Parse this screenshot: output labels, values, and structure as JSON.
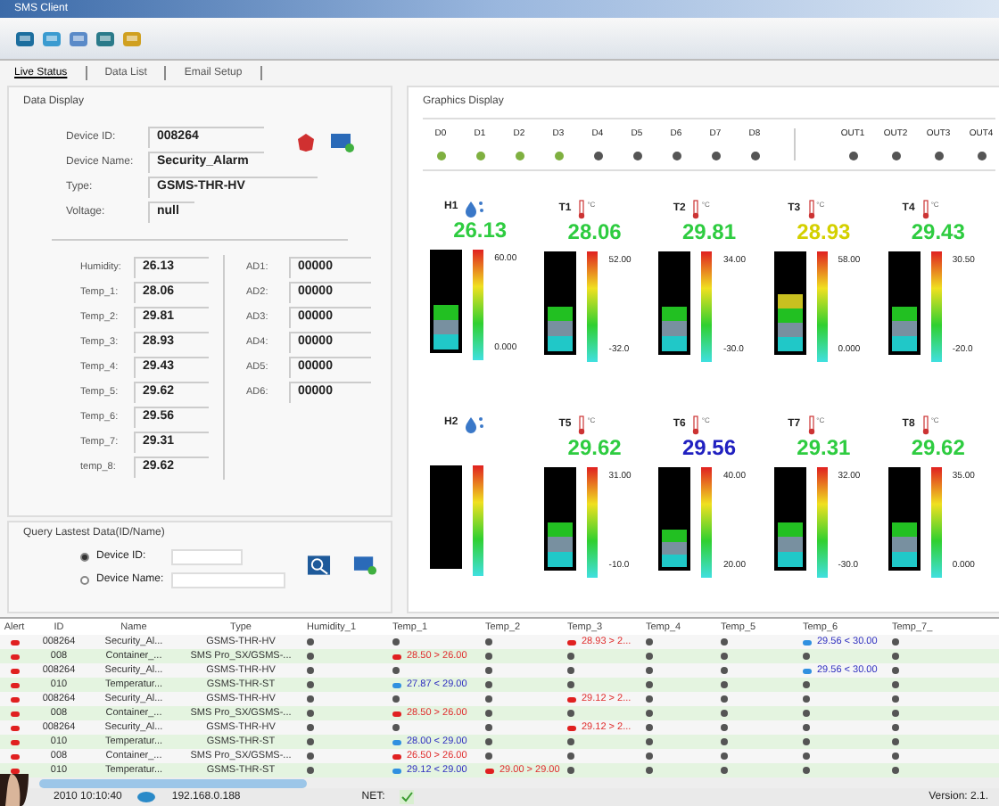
{
  "window": {
    "title": "SMS Client"
  },
  "tabs": [
    {
      "label": "Live Status",
      "selected": true
    },
    {
      "label": "Data List",
      "selected": false
    },
    {
      "label": "Email Setup",
      "selected": false
    }
  ],
  "data_display": {
    "title": "Data Display",
    "device_fields": [
      {
        "label": "Device ID:",
        "value": "008264"
      },
      {
        "label": "Device Name:",
        "value": "Security_Alarm"
      },
      {
        "label": "Type:",
        "value": "GSMS-THR-HV"
      },
      {
        "label": "Voltage:",
        "value": "null"
      }
    ],
    "readings": [
      {
        "label": "Humidity:",
        "value": "26.13"
      },
      {
        "label": "Temp_1:",
        "value": "28.06"
      },
      {
        "label": "Temp_2:",
        "value": "29.81"
      },
      {
        "label": "Temp_3:",
        "value": "28.93"
      },
      {
        "label": "Temp_4:",
        "value": "29.43"
      },
      {
        "label": "Temp_5:",
        "value": "29.62"
      },
      {
        "label": "Temp_6:",
        "value": "29.56"
      },
      {
        "label": "Temp_7:",
        "value": "29.31"
      },
      {
        "label": "temp_8:",
        "value": "29.62"
      }
    ],
    "analog": [
      {
        "label": "AD1:",
        "value": "00000"
      },
      {
        "label": "AD2:",
        "value": "00000"
      },
      {
        "label": "AD3:",
        "value": "00000"
      },
      {
        "label": "AD4:",
        "value": "00000"
      },
      {
        "label": "AD5:",
        "value": "00000"
      },
      {
        "label": "AD6:",
        "value": "00000"
      }
    ]
  },
  "query": {
    "title": "Query Lastest Data(ID/Name)",
    "options": [
      {
        "label": "Device ID:",
        "selected": true
      },
      {
        "label": "Device Name:",
        "selected": false
      }
    ]
  },
  "graphics": {
    "title": "Graphics Display",
    "inputs": [
      {
        "label": "D0",
        "on": true
      },
      {
        "label": "D1",
        "on": true
      },
      {
        "label": "D2",
        "on": true
      },
      {
        "label": "D3",
        "on": true
      },
      {
        "label": "D4",
        "on": false
      },
      {
        "label": "D5",
        "on": false
      },
      {
        "label": "D6",
        "on": false
      },
      {
        "label": "D7",
        "on": false
      },
      {
        "label": "D8",
        "on": false
      }
    ],
    "outputs": [
      {
        "label": "OUT1",
        "on": false
      },
      {
        "label": "OUT2",
        "on": false
      },
      {
        "label": "OUT3",
        "on": false
      },
      {
        "label": "OUT4",
        "on": false
      }
    ],
    "gauges": [
      {
        "name": "H1",
        "kind": "humidity",
        "value": "26.13",
        "color": "#2ecc40",
        "level": 0.45,
        "max": "60.00",
        "min": "0.000"
      },
      {
        "name": "T1",
        "kind": "temperature",
        "unit": "°C",
        "value": "28.06",
        "color": "#2ecc40",
        "level": 0.45,
        "max": "52.00",
        "min": "-32.0"
      },
      {
        "name": "T2",
        "kind": "temperature",
        "unit": "°C",
        "value": "29.81",
        "color": "#2ecc40",
        "level": 0.45,
        "max": "34.00",
        "min": "-30.0"
      },
      {
        "name": "T3",
        "kind": "temperature",
        "unit": "°C",
        "value": "28.93",
        "color": "#d4d000",
        "level": 0.58,
        "max": "58.00",
        "min": "0.000"
      },
      {
        "name": "T4",
        "kind": "temperature",
        "unit": "°C",
        "value": "29.43",
        "color": "#2ecc40",
        "level": 0.45,
        "max": "30.50",
        "min": "-20.0"
      },
      {
        "name": "H2",
        "kind": "humidity",
        "level": 0
      },
      {
        "name": "T5",
        "kind": "temperature",
        "unit": "°C",
        "value": "29.62",
        "color": "#2ecc40",
        "level": 0.45,
        "max": "31.00",
        "min": "-10.0"
      },
      {
        "name": "T6",
        "kind": "temperature",
        "unit": "°C",
        "value": "29.56",
        "color": "#2020c0",
        "level": 0.38,
        "max": "40.00",
        "min": "20.00"
      },
      {
        "name": "T7",
        "kind": "temperature",
        "unit": "°C",
        "value": "29.31",
        "color": "#2ecc40",
        "level": 0.45,
        "max": "32.00",
        "min": "-30.0"
      },
      {
        "name": "T8",
        "kind": "temperature",
        "unit": "°C",
        "value": "29.62",
        "color": "#2ecc40",
        "level": 0.45,
        "max": "35.00",
        "min": "0.000"
      }
    ]
  },
  "table": {
    "columns": [
      "Alert",
      "ID",
      "Name",
      "Type",
      "Humidity_1",
      "Temp_1",
      "Temp_2",
      "Temp_3",
      "Temp_4",
      "Temp_5",
      "Temp_6",
      "Temp_7_"
    ],
    "rows": [
      {
        "id": "008264",
        "name": "Security_Al...",
        "type": "GSMS-THR-HV",
        "sensors": [
          {
            "kind": "normal"
          },
          {
            "kind": "normal"
          },
          {
            "kind": "normal"
          },
          {
            "kind": "high",
            "text": "28.93 > 2..."
          },
          {
            "kind": "normal"
          },
          {
            "kind": "normal"
          },
          {
            "kind": "low",
            "text": "29.56 < 30.00"
          },
          {
            "kind": "normal"
          }
        ]
      },
      {
        "id": "008",
        "name": "Container_...",
        "type": "SMS Pro_SX/GSMS-...",
        "sensors": [
          {
            "kind": "normal"
          },
          {
            "kind": "high",
            "text": "28.50 > 26.00"
          },
          {
            "kind": "normal"
          },
          {
            "kind": "normal"
          },
          {
            "kind": "normal"
          },
          {
            "kind": "normal"
          },
          {
            "kind": "normal"
          },
          {
            "kind": "normal"
          }
        ]
      },
      {
        "id": "008264",
        "name": "Security_Al...",
        "type": "GSMS-THR-HV",
        "sensors": [
          {
            "kind": "normal"
          },
          {
            "kind": "normal"
          },
          {
            "kind": "normal"
          },
          {
            "kind": "normal"
          },
          {
            "kind": "normal"
          },
          {
            "kind": "normal"
          },
          {
            "kind": "low",
            "text": "29.56 < 30.00"
          },
          {
            "kind": "normal"
          }
        ]
      },
      {
        "id": "010",
        "name": "Temperatur...",
        "type": "GSMS-THR-ST",
        "sensors": [
          {
            "kind": "normal"
          },
          {
            "kind": "low",
            "text": "27.87 < 29.00"
          },
          {
            "kind": "normal"
          },
          {
            "kind": "normal"
          },
          {
            "kind": "normal"
          },
          {
            "kind": "normal"
          },
          {
            "kind": "normal"
          },
          {
            "kind": "normal"
          }
        ]
      },
      {
        "id": "008264",
        "name": "Security_Al...",
        "type": "GSMS-THR-HV",
        "sensors": [
          {
            "kind": "normal"
          },
          {
            "kind": "normal"
          },
          {
            "kind": "normal"
          },
          {
            "kind": "high",
            "text": "29.12 > 2..."
          },
          {
            "kind": "normal"
          },
          {
            "kind": "normal"
          },
          {
            "kind": "normal"
          },
          {
            "kind": "normal"
          }
        ]
      },
      {
        "id": "008",
        "name": "Container_...",
        "type": "SMS Pro_SX/GSMS-...",
        "sensors": [
          {
            "kind": "normal"
          },
          {
            "kind": "high",
            "text": "28.50 > 26.00"
          },
          {
            "kind": "normal"
          },
          {
            "kind": "normal"
          },
          {
            "kind": "normal"
          },
          {
            "kind": "normal"
          },
          {
            "kind": "normal"
          },
          {
            "kind": "normal"
          }
        ]
      },
      {
        "id": "008264",
        "name": "Security_Al...",
        "type": "GSMS-THR-HV",
        "sensors": [
          {
            "kind": "normal"
          },
          {
            "kind": "normal"
          },
          {
            "kind": "normal"
          },
          {
            "kind": "high",
            "text": "29.12 > 2..."
          },
          {
            "kind": "normal"
          },
          {
            "kind": "normal"
          },
          {
            "kind": "normal"
          },
          {
            "kind": "normal"
          }
        ]
      },
      {
        "id": "010",
        "name": "Temperatur...",
        "type": "GSMS-THR-ST",
        "sensors": [
          {
            "kind": "normal"
          },
          {
            "kind": "low",
            "text": "28.00 < 29.00"
          },
          {
            "kind": "normal"
          },
          {
            "kind": "normal"
          },
          {
            "kind": "normal"
          },
          {
            "kind": "normal"
          },
          {
            "kind": "normal"
          },
          {
            "kind": "normal"
          }
        ]
      },
      {
        "id": "008",
        "name": "Container_...",
        "type": "SMS Pro_SX/GSMS-...",
        "sensors": [
          {
            "kind": "normal"
          },
          {
            "kind": "high",
            "text": "26.50 > 26.00"
          },
          {
            "kind": "normal"
          },
          {
            "kind": "normal"
          },
          {
            "kind": "normal"
          },
          {
            "kind": "normal"
          },
          {
            "kind": "normal"
          },
          {
            "kind": "normal"
          }
        ]
      },
      {
        "id": "010",
        "name": "Temperatur...",
        "type": "GSMS-THR-ST",
        "sensors": [
          {
            "kind": "normal"
          },
          {
            "kind": "low",
            "text": "29.12 < 29.00"
          },
          {
            "kind": "high",
            "text": "29.00 > 29.00"
          },
          {
            "kind": "normal"
          },
          {
            "kind": "normal"
          },
          {
            "kind": "normal"
          },
          {
            "kind": "normal"
          },
          {
            "kind": "normal"
          }
        ]
      }
    ]
  },
  "status_bar": {
    "time": "2010 10:10:40",
    "ip": "192.168.0.188",
    "net_label": "NET:",
    "version": "Version: 2.1."
  }
}
